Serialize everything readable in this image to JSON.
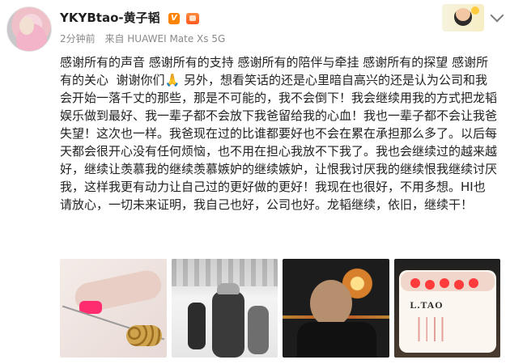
{
  "header": {
    "username": "YKYBtao-黄子韬",
    "verified_icon": "verified-v-icon",
    "vip_icon": "vip-badge-icon",
    "meta_time": "2分钟前",
    "meta_source": "来自 HUAWEI Mate Xs 5G"
  },
  "post": {
    "text": "感谢所有的声音 感谢所有的支持 感谢所有的陪伴与牵挂 感谢所有的探望 感谢所有的关心  谢谢你们🙏 另外，想看笑话的还是心里暗自高兴的还是认为公司和我会开始一落千丈的那些，那是不可能的，我不会倒下！我会继续用我的方式把龙韬娱乐做到最好、我一辈子都不会放下我爸留给我的心血！我也一辈子都不会让我爸失望！这次也一样。我爸现在过的比谁都要好也不会在累在承担那么多了。以后每天都会很开心没有任何烦恼，也不用在担心我放不下我了。我也会继续过的越来越好，继续让羡慕我的继续羡慕嫉妒的继续嫉妒，让恨我讨厌我的继续恨我继续讨厌我，这样我更有动力让自己过的更好做的更好！我现在也很好，不用多想。HI也请放心，一切未来证明，我自己也好，公司也好。龙韬继续，依旧，继续干！"
  },
  "media": {
    "thumb4_text": "L.TAO"
  },
  "icons": {
    "avatar": "avatar-image",
    "caricature": "caricature-sticker",
    "chevron": "chevron-down-icon"
  }
}
